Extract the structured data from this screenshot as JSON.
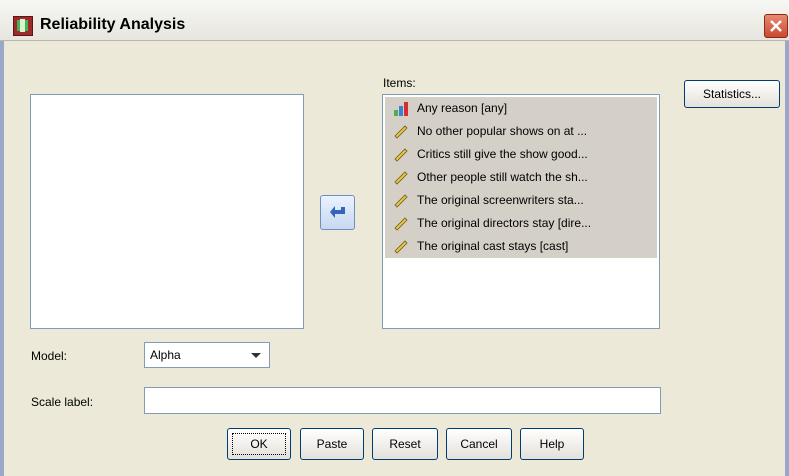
{
  "window": {
    "title": "Reliability Analysis",
    "title_icon": "spss-dialog-icon",
    "close_icon": "close-icon"
  },
  "items": {
    "label": "Items:",
    "list": [
      {
        "label": "Any reason [any]",
        "icon": "nominal-bar-icon"
      },
      {
        "label": "No other popular shows on at ...",
        "icon": "scale-ruler-icon"
      },
      {
        "label": "Critics still give the show good...",
        "icon": "scale-ruler-icon"
      },
      {
        "label": "Other people still watch the sh...",
        "icon": "scale-ruler-icon"
      },
      {
        "label": "The original screenwriters sta...",
        "icon": "scale-ruler-icon"
      },
      {
        "label": "The original directors stay [dire...",
        "icon": "scale-ruler-icon"
      },
      {
        "label": "The original cast stays [cast]",
        "icon": "scale-ruler-icon"
      }
    ]
  },
  "buttons": {
    "statistics": "Statistics...",
    "ok": "OK",
    "paste": "Paste",
    "reset": "Reset",
    "cancel": "Cancel",
    "help": "Help"
  },
  "model": {
    "label": "Model:",
    "value": "Alpha"
  },
  "scale_label": {
    "label": "Scale label:",
    "value": ""
  },
  "colors": {
    "selection": "#d4d0c8",
    "dialog_bg": "#ece9d8",
    "close": "#c84a2f"
  }
}
